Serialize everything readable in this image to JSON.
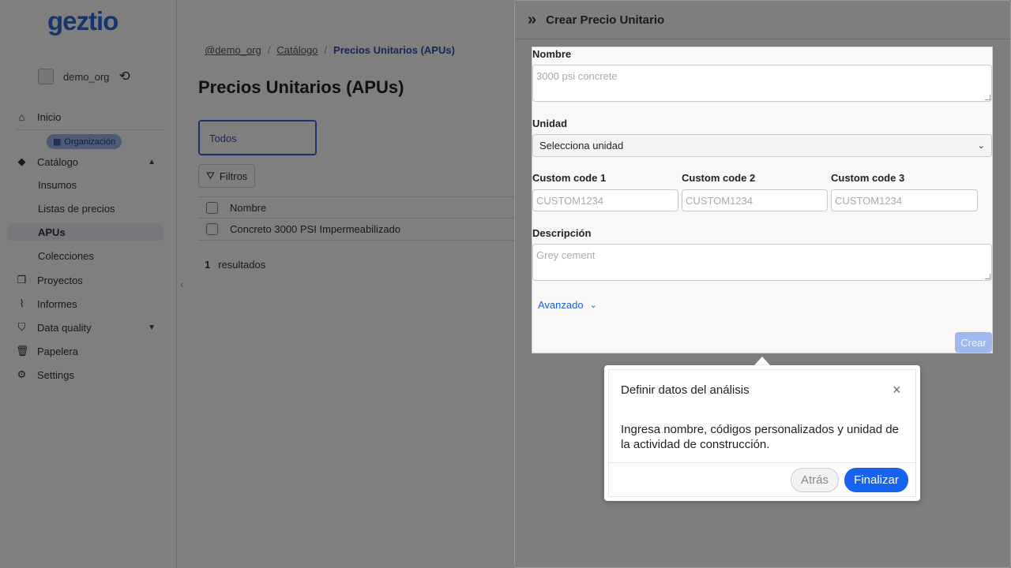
{
  "app": {
    "logo": "geztio",
    "org_name": "demo_org",
    "org_badge": "Organización",
    "nav": {
      "inicio": "Inicio",
      "catalogo": "Catálogo",
      "insumos": "Insumos",
      "listas": "Listas de precios",
      "apus": "APUs",
      "colecciones": "Colecciones",
      "proyectos": "Proyectos",
      "informes": "Informes",
      "data_quality": "Data quality",
      "papelera": "Papelera",
      "settings": "Settings"
    },
    "breadcrumb": [
      "@demo_org",
      "Catálogo",
      "Precios Unitarios (APUs)"
    ],
    "page_title": "Precios Unitarios (APUs)",
    "tab_label": "Todos",
    "filter_label": "Filtros",
    "table": {
      "header": "Nombre",
      "rows": [
        "Concreto 3000 PSI Impermeabilizado"
      ]
    },
    "results": {
      "count": "1",
      "label": "resultados"
    }
  },
  "drawer": {
    "title": "Crear Precio Unitario",
    "form": {
      "nombre_label": "Nombre",
      "nombre_placeholder": "3000 psi concrete",
      "unidad_label": "Unidad",
      "unidad_value": "Selecciona unidad",
      "custom1_label": "Custom code 1",
      "custom2_label": "Custom code 2",
      "custom3_label": "Custom code 3",
      "custom_placeholder": "CUSTOM1234",
      "descripcion_label": "Descripción",
      "descripcion_placeholder": "Grey cement",
      "advanced_label": "Avanzado",
      "submit_label": "Crear"
    }
  },
  "tour": {
    "title": "Definir datos del análisis",
    "text": "Ingresa nombre, códigos personalizados y unidad de la actividad de construcción.",
    "back_label": "Atrás",
    "finish_label": "Finalizar",
    "close_symbol": "×"
  },
  "colors": {
    "accent": "#1663f0",
    "logo": "#2f6ad9",
    "overlay": "rgba(0,0,0,0.5)"
  }
}
